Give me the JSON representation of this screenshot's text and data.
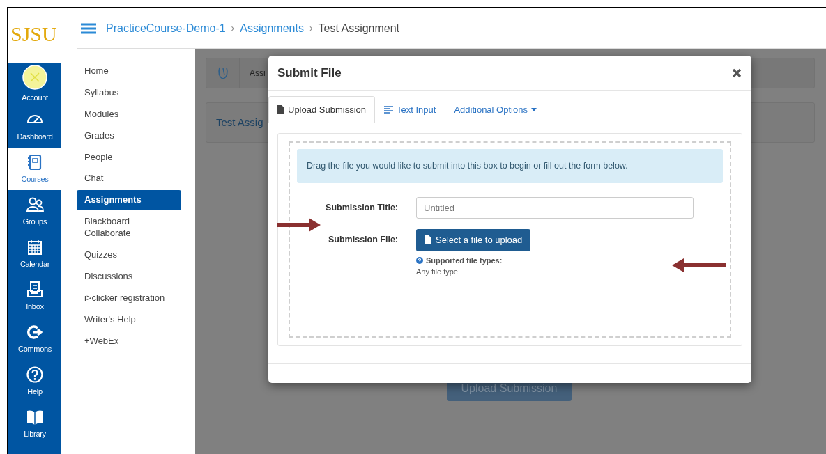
{
  "header": {
    "logo": "SJSU",
    "breadcrumb": [
      {
        "kind": "link",
        "label": "PracticeCourse-Demo-1"
      },
      {
        "kind": "separator",
        "label": "›"
      },
      {
        "kind": "link",
        "label": "Assignments"
      },
      {
        "kind": "separator",
        "label": "›"
      },
      {
        "kind": "current",
        "label": "Test Assignment"
      }
    ]
  },
  "global_nav": [
    {
      "kind": "avatar",
      "label": "Account",
      "selected": false
    },
    {
      "kind": "icon",
      "label": "Dashboard",
      "selected": false
    },
    {
      "kind": "icon",
      "label": "Courses",
      "selected": true
    },
    {
      "kind": "icon",
      "label": "Groups",
      "selected": false
    },
    {
      "kind": "icon",
      "label": "Calendar",
      "selected": false
    },
    {
      "kind": "icon",
      "label": "Inbox",
      "selected": false
    },
    {
      "kind": "icon",
      "label": "Commons",
      "selected": false
    },
    {
      "kind": "icon",
      "label": "Help",
      "selected": false
    },
    {
      "kind": "icon",
      "label": "Library",
      "selected": false
    }
  ],
  "course_nav": [
    {
      "label": "Home",
      "selected": false
    },
    {
      "label": "Syllabus",
      "selected": false
    },
    {
      "label": "Modules",
      "selected": false
    },
    {
      "label": "Grades",
      "selected": false
    },
    {
      "label": "People",
      "selected": false
    },
    {
      "label": "Chat",
      "selected": false
    },
    {
      "label": "Assignments",
      "selected": true
    },
    {
      "label": "Blackboard Collaborate",
      "selected": false
    },
    {
      "label": "Quizzes",
      "selected": false
    },
    {
      "label": "Discussions",
      "selected": false
    },
    {
      "label": "i>clicker registration",
      "selected": false
    },
    {
      "label": "Writer's Help",
      "selected": false
    },
    {
      "label": "+WebEx",
      "selected": false
    }
  ],
  "page_behind": {
    "toolbar_text": "Assi",
    "title": "Test Assig",
    "button": "Upload Submission"
  },
  "modal": {
    "title": "Submit File",
    "tabs": [
      {
        "kind": "file",
        "label": "Upload Submission",
        "selected": true
      },
      {
        "kind": "lines",
        "label": "Text Input",
        "selected": false
      },
      {
        "kind": "dropdown",
        "label": "Additional Options",
        "selected": false
      }
    ],
    "alert": "Drag the file you would like to submit into this box to begin or fill out the form below.",
    "title_label": "Submission Title:",
    "title_placeholder": "Untitled",
    "file_label": "Submission File:",
    "file_button": "Select a file to upload",
    "help_title": "Supported file types:",
    "help_text": "Any file type"
  },
  "annotations": [
    {
      "kind": "right"
    },
    {
      "kind": "left"
    }
  ]
}
